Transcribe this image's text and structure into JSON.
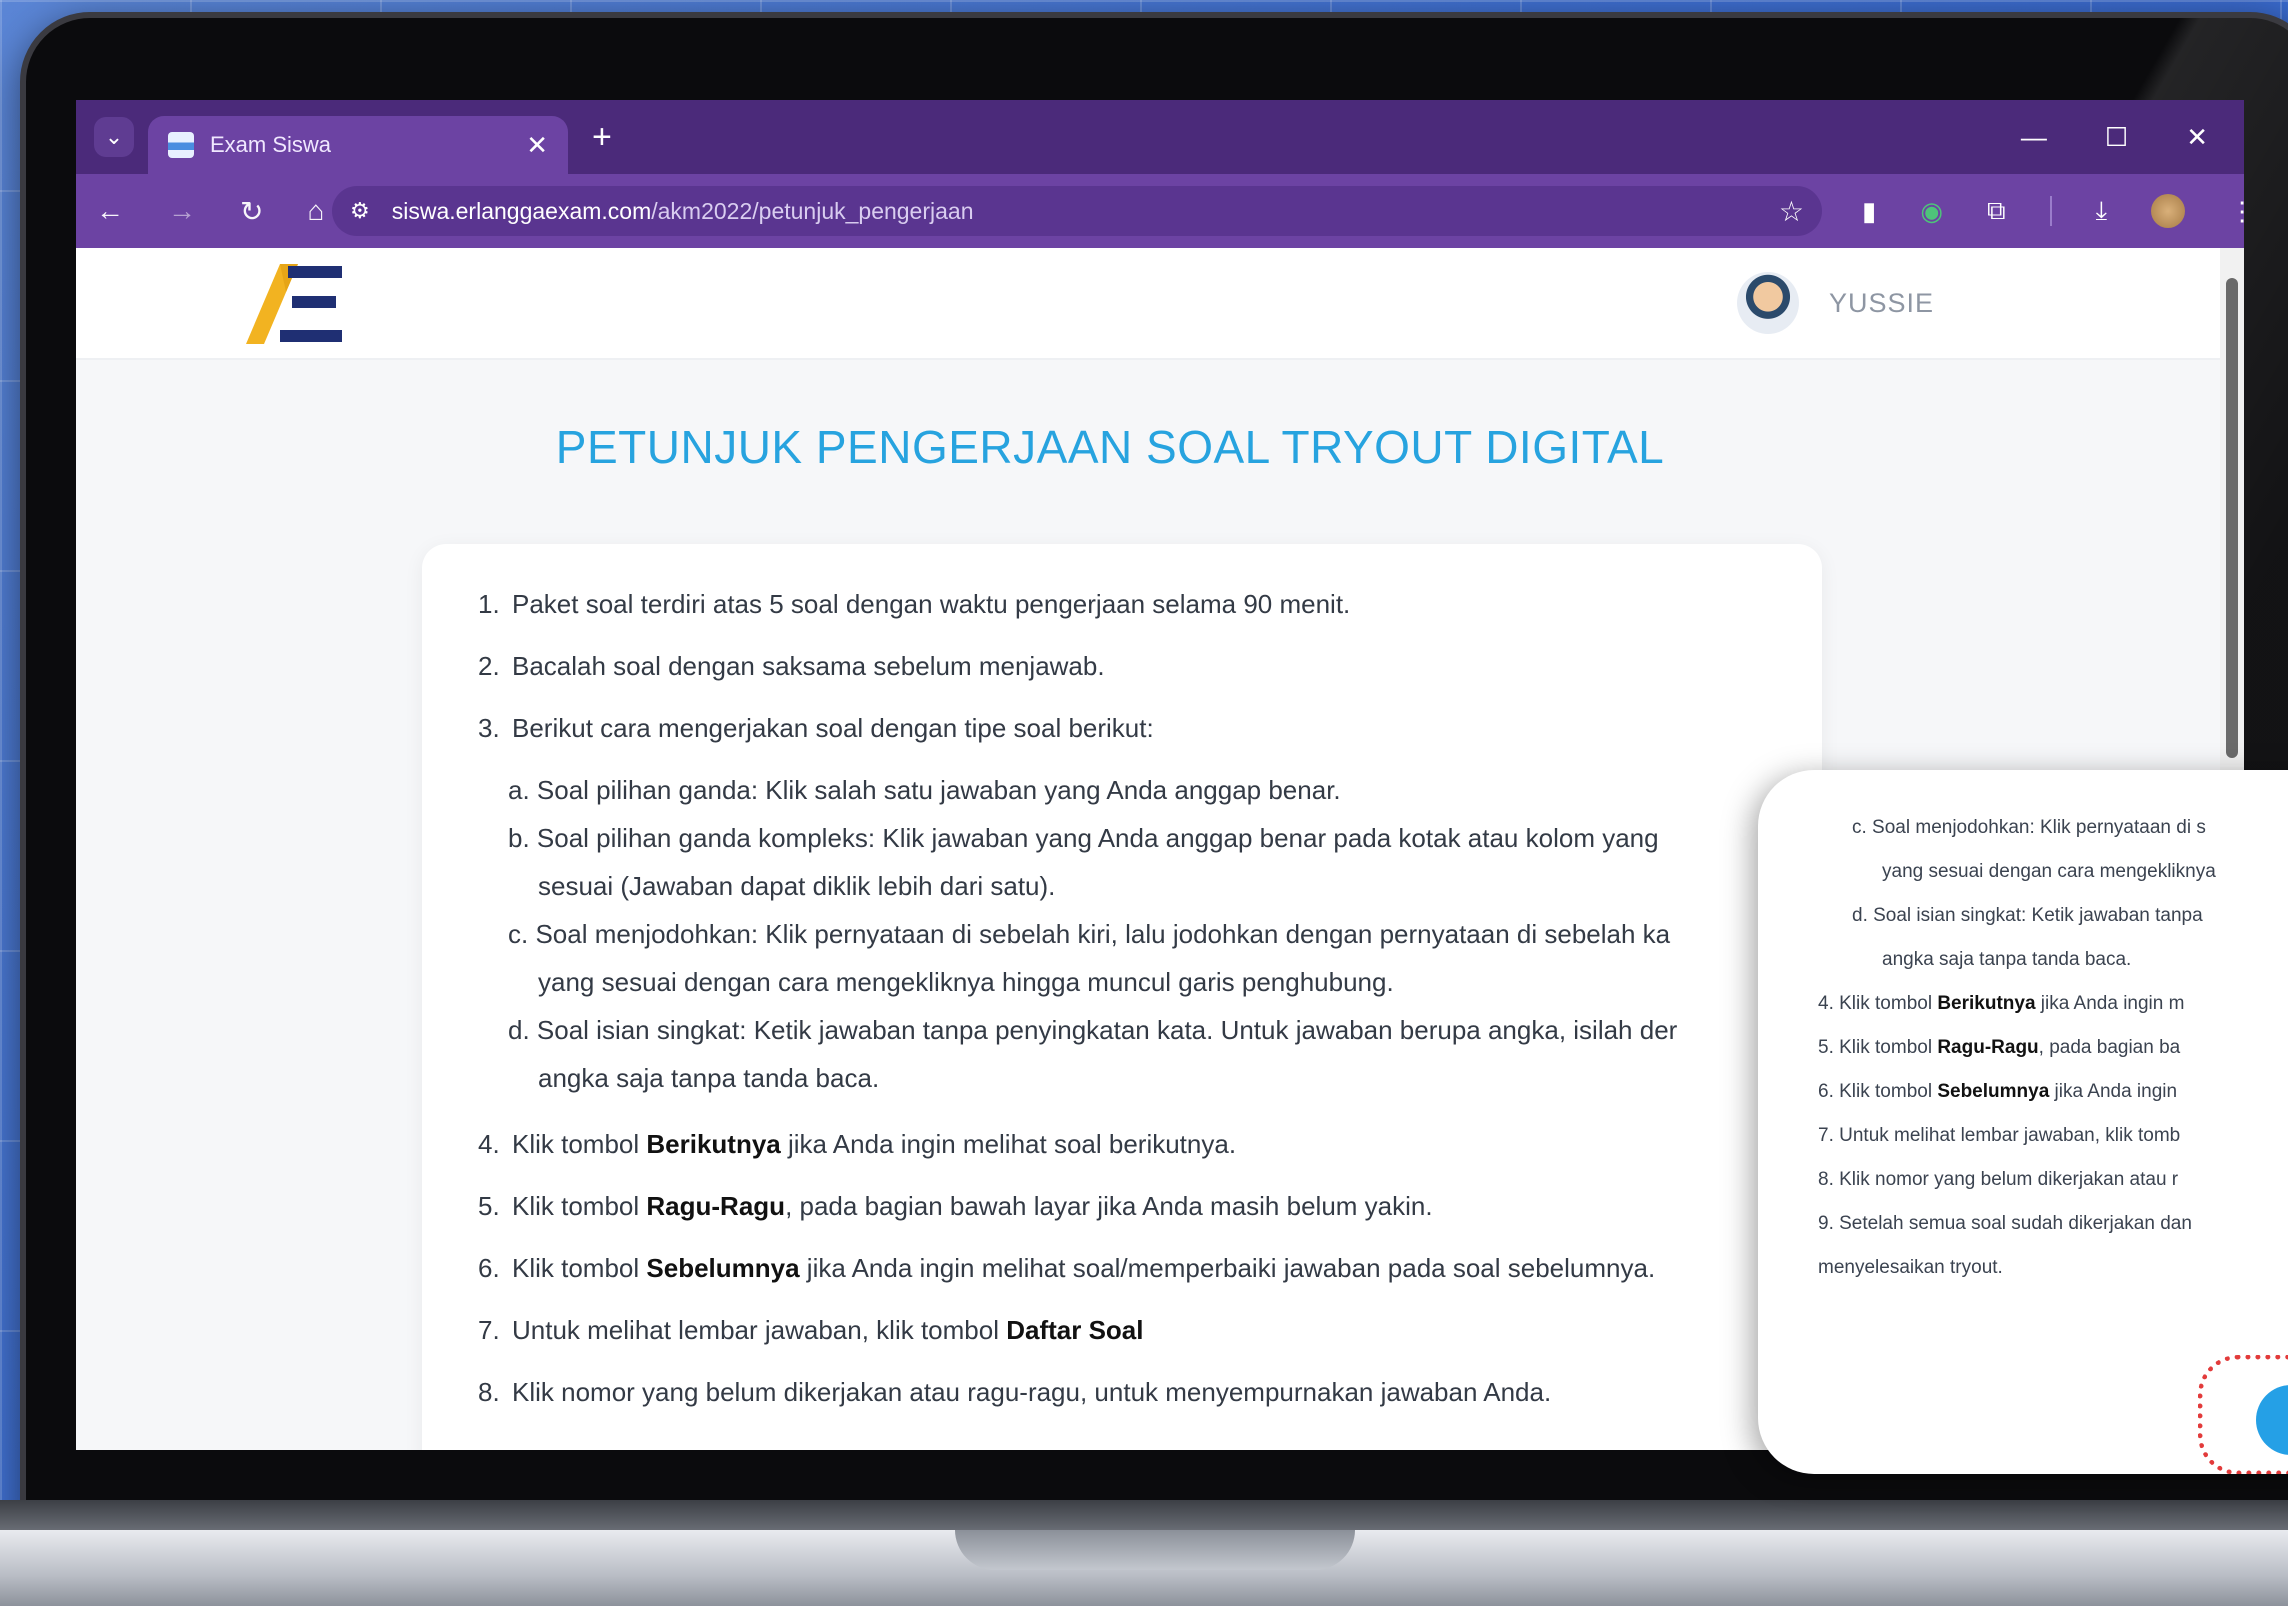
{
  "browser": {
    "tab_title": "Exam Siswa",
    "url_host": "siswa.erlanggaexam.com",
    "url_path": "/akm2022/petunjuk_pengerjaan"
  },
  "header": {
    "username": "YUSSIE"
  },
  "page": {
    "title": "PETUNJUK PENGERJAAN SOAL TRYOUT DIGITAL"
  },
  "instructions": {
    "i1": "Paket soal terdiri atas 5 soal dengan waktu pengerjaan selama 90 menit.",
    "i2": "Bacalah soal dengan saksama sebelum menjawab.",
    "i3": "Berikut cara mengerjakan soal dengan tipe soal berikut:",
    "i3a": "a. Soal pilihan ganda: Klik salah satu jawaban yang Anda anggap benar.",
    "i3b": "b. Soal pilihan ganda kompleks: Klik jawaban yang Anda anggap benar pada kotak atau kolom yang",
    "i3b_cont": "sesuai (Jawaban dapat diklik lebih dari satu).",
    "i3c": "c. Soal menjodohkan: Klik pernyataan di sebelah kiri, lalu jodohkan dengan pernyataan di sebelah ka",
    "i3c_cont": "yang sesuai dengan cara mengekliknya hingga muncul garis penghubung.",
    "i3d": "d. Soal isian singkat: Ketik jawaban tanpa penyingkatan kata. Untuk jawaban berupa angka, isilah der",
    "i3d_cont": "angka saja tanpa tanda baca.",
    "i4_pre": "Klik tombol ",
    "i4_bold": "Berikutnya",
    "i4_post": " jika Anda ingin melihat soal berikutnya.",
    "i5_pre": "Klik tombol ",
    "i5_bold": "Ragu-Ragu",
    "i5_post": ", pada bagian bawah layar jika Anda masih belum yakin.",
    "i6_pre": "Klik tombol ",
    "i6_bold": "Sebelumnya",
    "i6_post": " jika Anda ingin melihat soal/memperbaiki jawaban pada soal sebelumnya.",
    "i7_pre": "Untuk melihat lembar jawaban, klik tombol ",
    "i7_bold": "Daftar Soal",
    "i8": "Klik nomor yang belum dikerjakan atau ragu-ragu, untuk menyempurnakan jawaban Anda."
  },
  "zoom": {
    "c": "c. Soal menjodohkan: Klik pernyataan di s",
    "c_cont": "yang sesuai dengan cara mengekliknya",
    "d": "d. Soal isian singkat: Ketik jawaban tanpa",
    "d_cont": "angka saja tanpa tanda baca.",
    "i4_pre": "4. Klik tombol ",
    "i4_bold": "Berikutnya",
    "i4_post": " jika Anda ingin m",
    "i5_pre": "5. Klik tombol ",
    "i5_bold": "Ragu-Ragu",
    "i5_post": ", pada bagian ba",
    "i6_pre": "6. Klik tombol ",
    "i6_bold": "Sebelumnya",
    "i6_post": " jika Anda ingin",
    "i7": "7. Untuk melihat lembar jawaban, klik tomb",
    "i8": "8. Klik nomor yang belum dikerjakan atau r",
    "i9": "9. Setelah semua soal sudah dikerjakan dan",
    "i9_cont": "menyelesaikan tryout."
  },
  "colors": {
    "browser_frame": "#4b2a7a",
    "title": "#27a3df",
    "highlight": "#e23b3b"
  }
}
